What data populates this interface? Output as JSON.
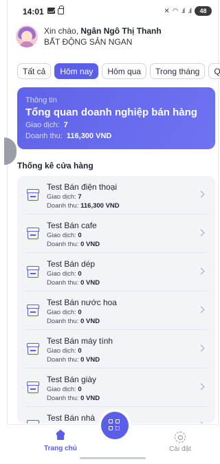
{
  "status_bar": {
    "time": "14:01",
    "battery": "48"
  },
  "greeting": {
    "hello": "Xin chào,",
    "name": "Ngân Ngô Thị Thanh",
    "company": "BẤT ĐỘNG SẢN NGAN"
  },
  "filters": [
    {
      "label": "Tất cả",
      "active": false
    },
    {
      "label": "Hôm nay",
      "active": true
    },
    {
      "label": "Hôm qua",
      "active": false
    },
    {
      "label": "Trong tháng",
      "active": false
    },
    {
      "label": "Quý n",
      "active": false
    }
  ],
  "overview": {
    "label": "Thông tin",
    "title": "Tổng quan doanh nghiệp bán hàng",
    "transactions_label": "Giao dịch:",
    "transactions_value": "7",
    "revenue_label": "Doanh thu:",
    "revenue_value": "116,300 VND"
  },
  "section_title": "Thống kê cửa hàng",
  "stores": [
    {
      "name": "Test Bán điện thoại",
      "tx_label": "Giao dịch:",
      "tx": "7",
      "rev_label": "Doanh thu:",
      "rev": "116,300 VND"
    },
    {
      "name": "Test Bán cafe",
      "tx_label": "Giao dịch:",
      "tx": "0",
      "rev_label": "Doanh thu:",
      "rev": "0 VND"
    },
    {
      "name": "Test Bán dép",
      "tx_label": "Giao dịch:",
      "tx": "0",
      "rev_label": "Doanh thu:",
      "rev": "0 VND"
    },
    {
      "name": "Test Bán nước hoa",
      "tx_label": "Giao dịch:",
      "tx": "0",
      "rev_label": "Doanh thu:",
      "rev": "0 VND"
    },
    {
      "name": "Test Bán máy tính",
      "tx_label": "Giao dịch:",
      "tx": "0",
      "rev_label": "Doanh thu:",
      "rev": "0 VND"
    },
    {
      "name": "Test Bán giày",
      "tx_label": "Giao dịch:",
      "tx": "0",
      "rev_label": "Doanh thu:",
      "rev": "0 VND"
    },
    {
      "name": "Test Bán nhà",
      "tx_label": "",
      "tx": "",
      "rev_label": "",
      "rev": ""
    }
  ],
  "nav": {
    "home": "Trang chủ",
    "settings": "Cài đặt"
  },
  "colors": {
    "accent": "#5b5fe8",
    "background": "#ffffff",
    "list_bg": "#f3f4f7"
  }
}
